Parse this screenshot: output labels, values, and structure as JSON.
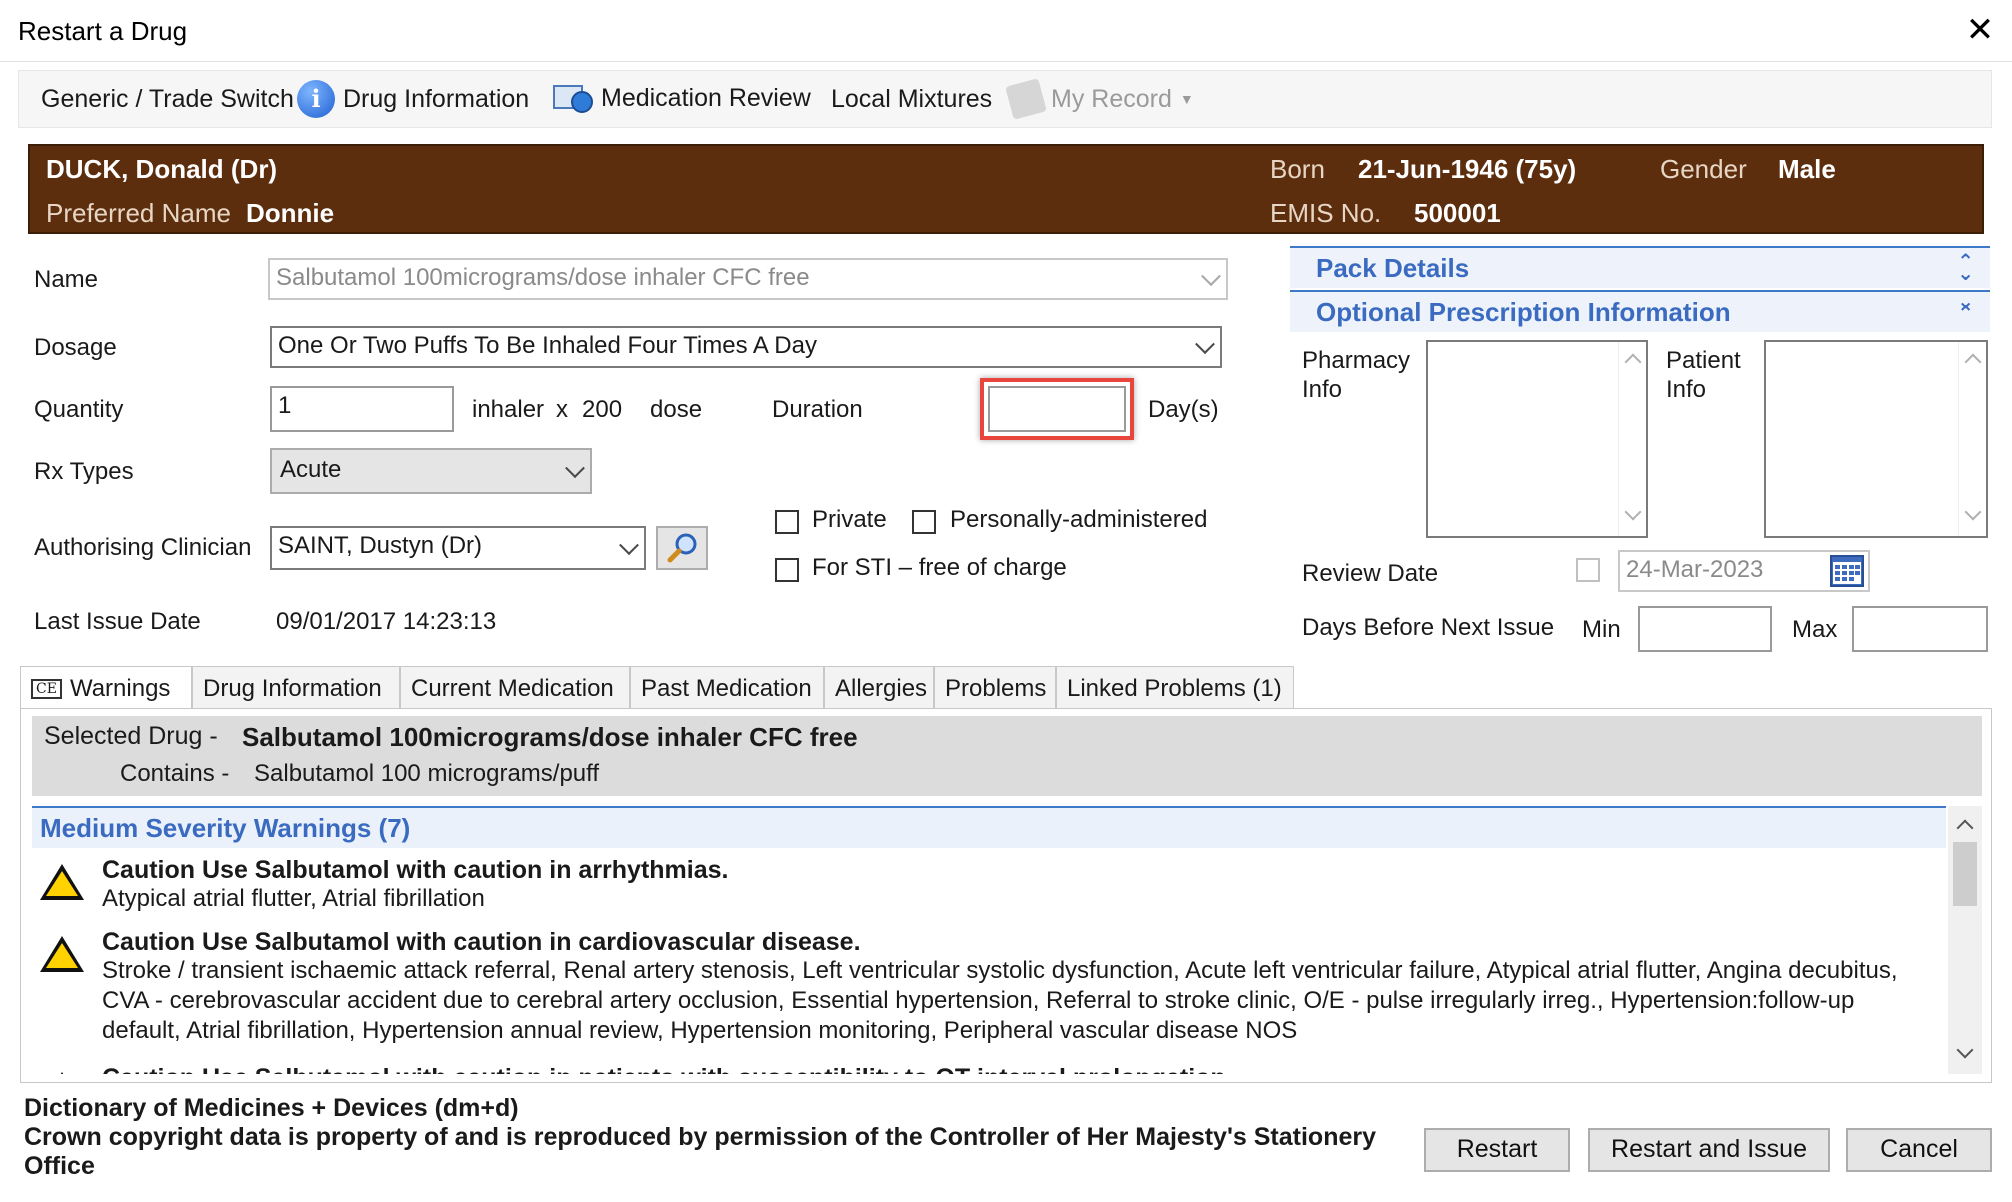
{
  "window": {
    "title": "Restart a Drug",
    "close_glyph": "✕"
  },
  "toolbar": {
    "generic_trade_switch": "Generic / Trade Switch",
    "drug_information": "Drug Information",
    "medication_review": "Medication Review",
    "local_mixtures": "Local Mixtures",
    "my_record": "My Record"
  },
  "patient": {
    "name": "DUCK, Donald (Dr)",
    "preferred_name_label": "Preferred Name",
    "preferred_name": "Donnie",
    "born_label": "Born",
    "born": "21-Jun-1946 (75y)",
    "gender_label": "Gender",
    "gender": "Male",
    "emis_label": "EMIS No.",
    "emis_no": "500001",
    "banner_color": "#5c2e0e"
  },
  "form": {
    "name_label": "Name",
    "name_value": "Salbutamol 100micrograms/dose inhaler CFC free",
    "dosage_label": "Dosage",
    "dosage_value": "One Or Two Puffs To Be Inhaled Four Times A Day",
    "quantity_label": "Quantity",
    "quantity_value": "1",
    "quantity_unit": "inhaler",
    "quantity_x": "x",
    "quantity_pack": "200",
    "quantity_dose": "dose",
    "duration_label": "Duration",
    "duration_value": "",
    "duration_unit": "Day(s)",
    "rx_types_label": "Rx Types",
    "rx_types_value": "Acute",
    "private_label": "Private",
    "personally_administered_label": "Personally-administered",
    "sti_label": "For STI – free of charge",
    "authorising_label": "Authorising Clinician",
    "authorising_value": "SAINT, Dustyn (Dr)",
    "last_issue_label": "Last Issue Date",
    "last_issue_value": "09/01/2017 14:23:13"
  },
  "right_panel": {
    "pack_details": "Pack Details",
    "optional_info": "Optional Prescription Information",
    "pharmacy_info_label": "Pharmacy Info",
    "patient_info_label": "Patient Info",
    "review_date_label": "Review Date",
    "review_date_value": "24-Mar-2023",
    "days_before_label": "Days Before Next Issue",
    "min_label": "Min",
    "max_label": "Max",
    "accent_color": "#3a6bc0"
  },
  "tabs": [
    {
      "label": "Warnings",
      "badge": "CE"
    },
    {
      "label": "Drug Information"
    },
    {
      "label": "Current Medication"
    },
    {
      "label": "Past Medication"
    },
    {
      "label": "Allergies"
    },
    {
      "label": "Problems"
    },
    {
      "label": "Linked Problems (1)"
    }
  ],
  "warnings": {
    "selected_drug_label": "Selected Drug -",
    "selected_drug_value": "Salbutamol 100micrograms/dose inhaler CFC free",
    "contains_label": "Contains -",
    "contains_value": "Salbutamol 100 micrograms/puff",
    "section_title": "Medium Severity Warnings (7)",
    "items": [
      {
        "title": "Caution  Use Salbutamol with caution in arrhythmias.",
        "body": "Atypical atrial flutter, Atrial fibrillation"
      },
      {
        "title": "Caution  Use Salbutamol with caution in cardiovascular disease.",
        "body": "Stroke / transient ischaemic attack referral, Renal artery stenosis, Left ventricular systolic dysfunction, Acute left ventricular failure, Atypical atrial flutter, Angina decubitus, CVA - cerebrovascular accident due to cerebral artery occlusion, Essential hypertension, Referral to stroke clinic, O/E - pulse irregularly irreg., Hypertension:follow-up default, Atrial fibrillation, Hypertension annual review, Hypertension monitoring, Peripheral vascular disease NOS"
      },
      {
        "title": "Caution  Use Salbutamol with caution in patients with susceptibility to QT-interval prolongation.",
        "body": ""
      }
    ]
  },
  "footer": {
    "line1": "Dictionary of Medicines + Devices (dm+d)",
    "line2": "Crown copyright data is property of and is reproduced by permission of the Controller of Her Majesty's Stationery Office",
    "restart": "Restart",
    "restart_and_issue": "Restart and Issue",
    "cancel": "Cancel"
  }
}
